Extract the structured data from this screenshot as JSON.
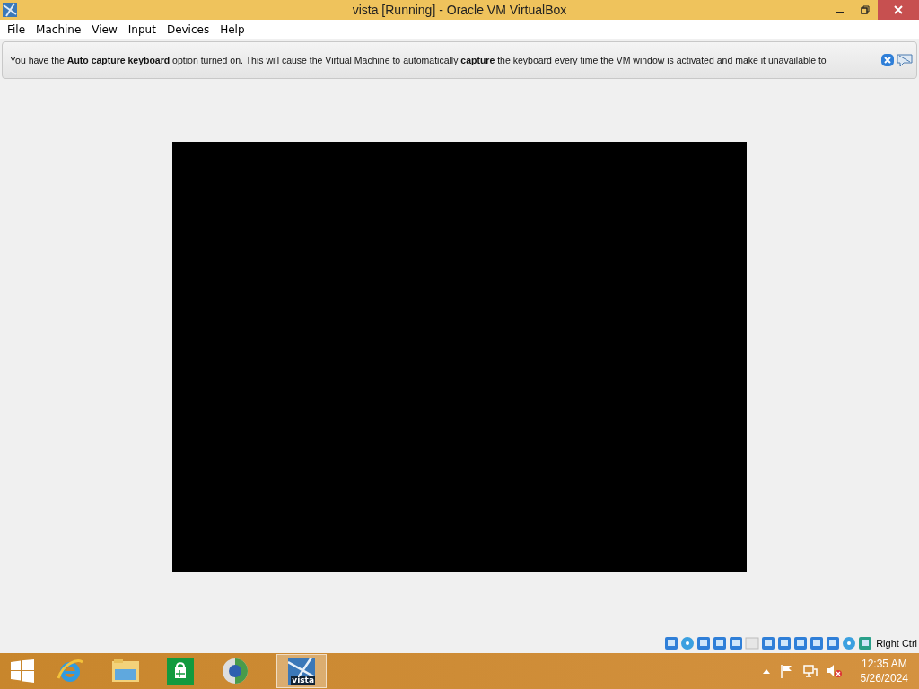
{
  "window": {
    "title": "vista [Running] - Oracle VM VirtualBox"
  },
  "menu": [
    "File",
    "Machine",
    "View",
    "Input",
    "Devices",
    "Help"
  ],
  "notification": {
    "text": "You have the **Auto capture keyboard** option turned on. This will cause the Virtual Machine to automatically **capture** the keyboard every time the VM window is activated and make it unavailable to"
  },
  "status_bar": {
    "host_key": "Right Ctrl"
  },
  "taskbar": {
    "running_app": {
      "label": "vista",
      "selected": true
    },
    "clock": {
      "time": "12:35 AM",
      "date": "5/26/2024"
    }
  }
}
